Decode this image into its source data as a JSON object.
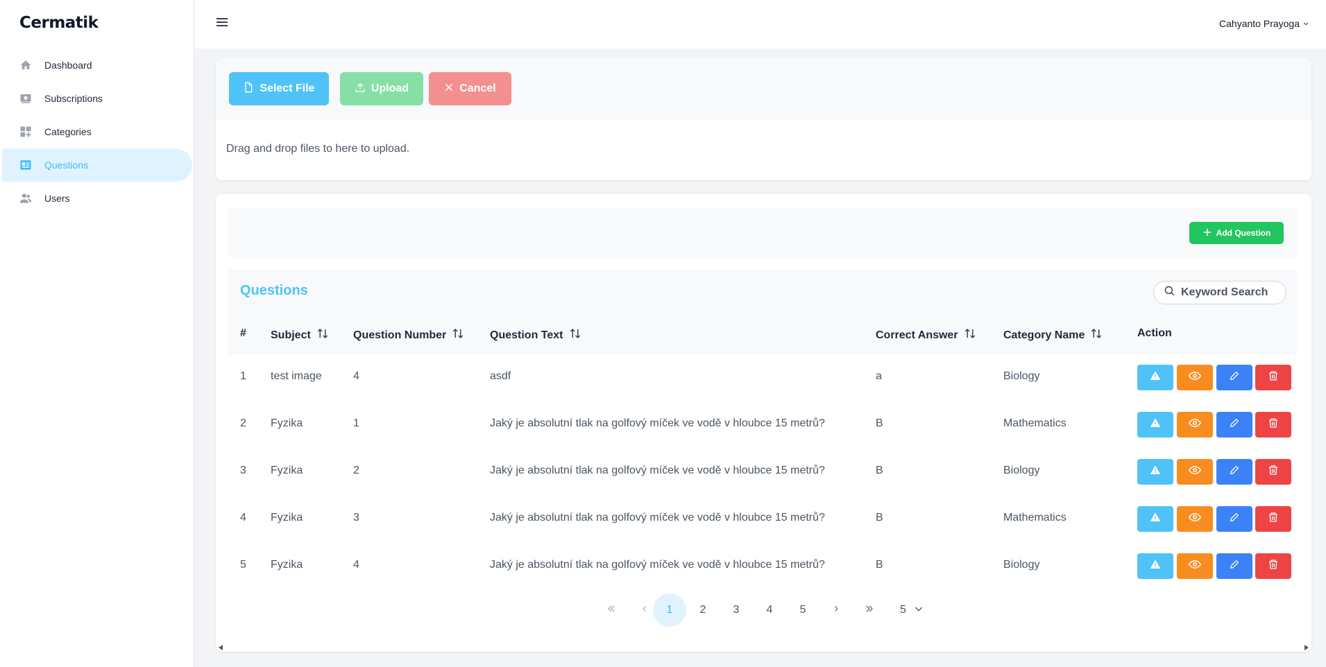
{
  "brand": "Cermatik",
  "sidebar": {
    "items": [
      {
        "label": "Dashboard",
        "icon": "home-icon"
      },
      {
        "label": "Subscriptions",
        "icon": "subscription-icon"
      },
      {
        "label": "Categories",
        "icon": "categories-icon"
      },
      {
        "label": "Questions",
        "icon": "questions-icon",
        "active": true
      },
      {
        "label": "Users",
        "icon": "users-icon"
      }
    ]
  },
  "topbar": {
    "user_name": "Cahyanto Prayoga"
  },
  "upload": {
    "select_label": "Select File",
    "upload_label": "Upload",
    "cancel_label": "Cancel",
    "drop_text": "Drag and drop files to here to upload."
  },
  "toolbar": {
    "add_label": "Add Question"
  },
  "table": {
    "title": "Questions",
    "search_placeholder": "Keyword Search",
    "headers": {
      "index": "#",
      "subject": "Subject",
      "question_number": "Question Number",
      "question_text": "Question Text",
      "correct_answer": "Correct Answer",
      "category_name": "Category Name",
      "action": "Action"
    },
    "rows": [
      {
        "index": "1",
        "subject": "test image",
        "question_number": "4",
        "question_text": "asdf",
        "correct_answer": "a",
        "category_name": "Biology"
      },
      {
        "index": "2",
        "subject": "Fyzika",
        "question_number": "1",
        "question_text": "Jaký je absolutní tlak na golfový míček ve vodě v hloubce 15 metrů?",
        "correct_answer": "B",
        "category_name": "Mathematics"
      },
      {
        "index": "3",
        "subject": "Fyzika",
        "question_number": "2",
        "question_text": "Jaký je absolutní tlak na golfový míček ve vodě v hloubce 15 metrů?",
        "correct_answer": "B",
        "category_name": "Biology"
      },
      {
        "index": "4",
        "subject": "Fyzika",
        "question_number": "3",
        "question_text": "Jaký je absolutní tlak na golfový míček ve vodě v hloubce 15 metrů?",
        "correct_answer": "B",
        "category_name": "Mathematics"
      },
      {
        "index": "5",
        "subject": "Fyzika",
        "question_number": "4",
        "question_text": "Jaký je absolutní tlak na golfový míček ve vodě v hloubce 15 metrů?",
        "correct_answer": "B",
        "category_name": "Biology"
      }
    ]
  },
  "pagination": {
    "pages": [
      "1",
      "2",
      "3",
      "4",
      "5"
    ],
    "current_page": "1",
    "rows_per_page": "5"
  },
  "colors": {
    "accent": "#4fc3f7",
    "success": "#22c55e",
    "warning": "#f98c1f",
    "primary": "#3b82f6",
    "danger": "#ef4444"
  }
}
